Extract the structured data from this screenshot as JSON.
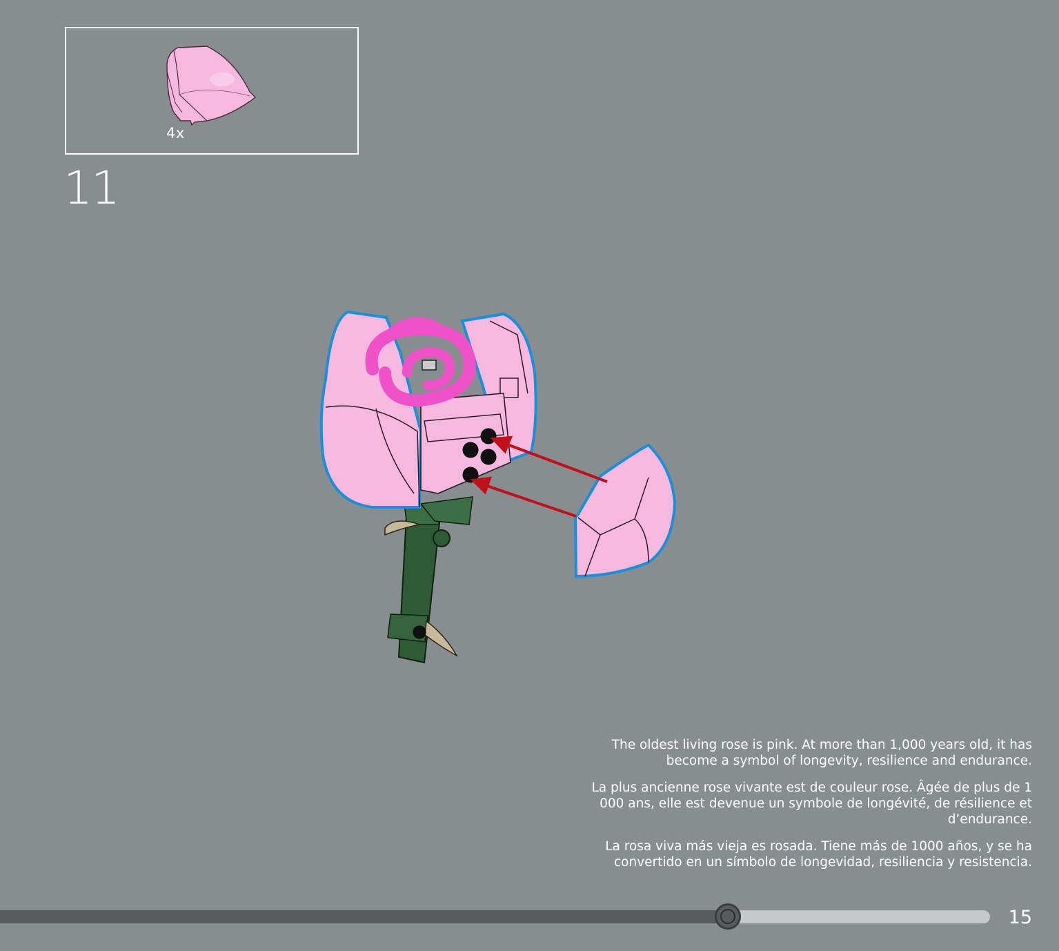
{
  "parts_list": {
    "count": "4x",
    "part_icon": "pink-curved-slope-brick-icon",
    "part_color": "#f6b8df"
  },
  "step": {
    "number": "11"
  },
  "fact_text": {
    "english": "The oldest living rose is pink. At more than 1,000 years old, it has become a symbol of longevity, resilience and endurance.",
    "french": "La plus ancienne rose vivante est de couleur rose. Âgée de plus de 1 000 ans, elle est devenue un symbole de longévité, de résilience et d’endurance.",
    "spanish": "La rosa viva más vieja es rosada. Tiene más de 1000 años, y se ha convertido en un símbolo de longevidad, resiliencia y resistencia."
  },
  "navigation": {
    "progress_fraction": 0.735,
    "page_number": "15"
  },
  "colors": {
    "background": "#888e8f",
    "petal_pink": "#f6b8df",
    "rose_magenta": "#f050c8",
    "stem_green": "#2f5a36",
    "highlight_blue": "#1a90d8",
    "arrow_red": "#c0101c"
  }
}
